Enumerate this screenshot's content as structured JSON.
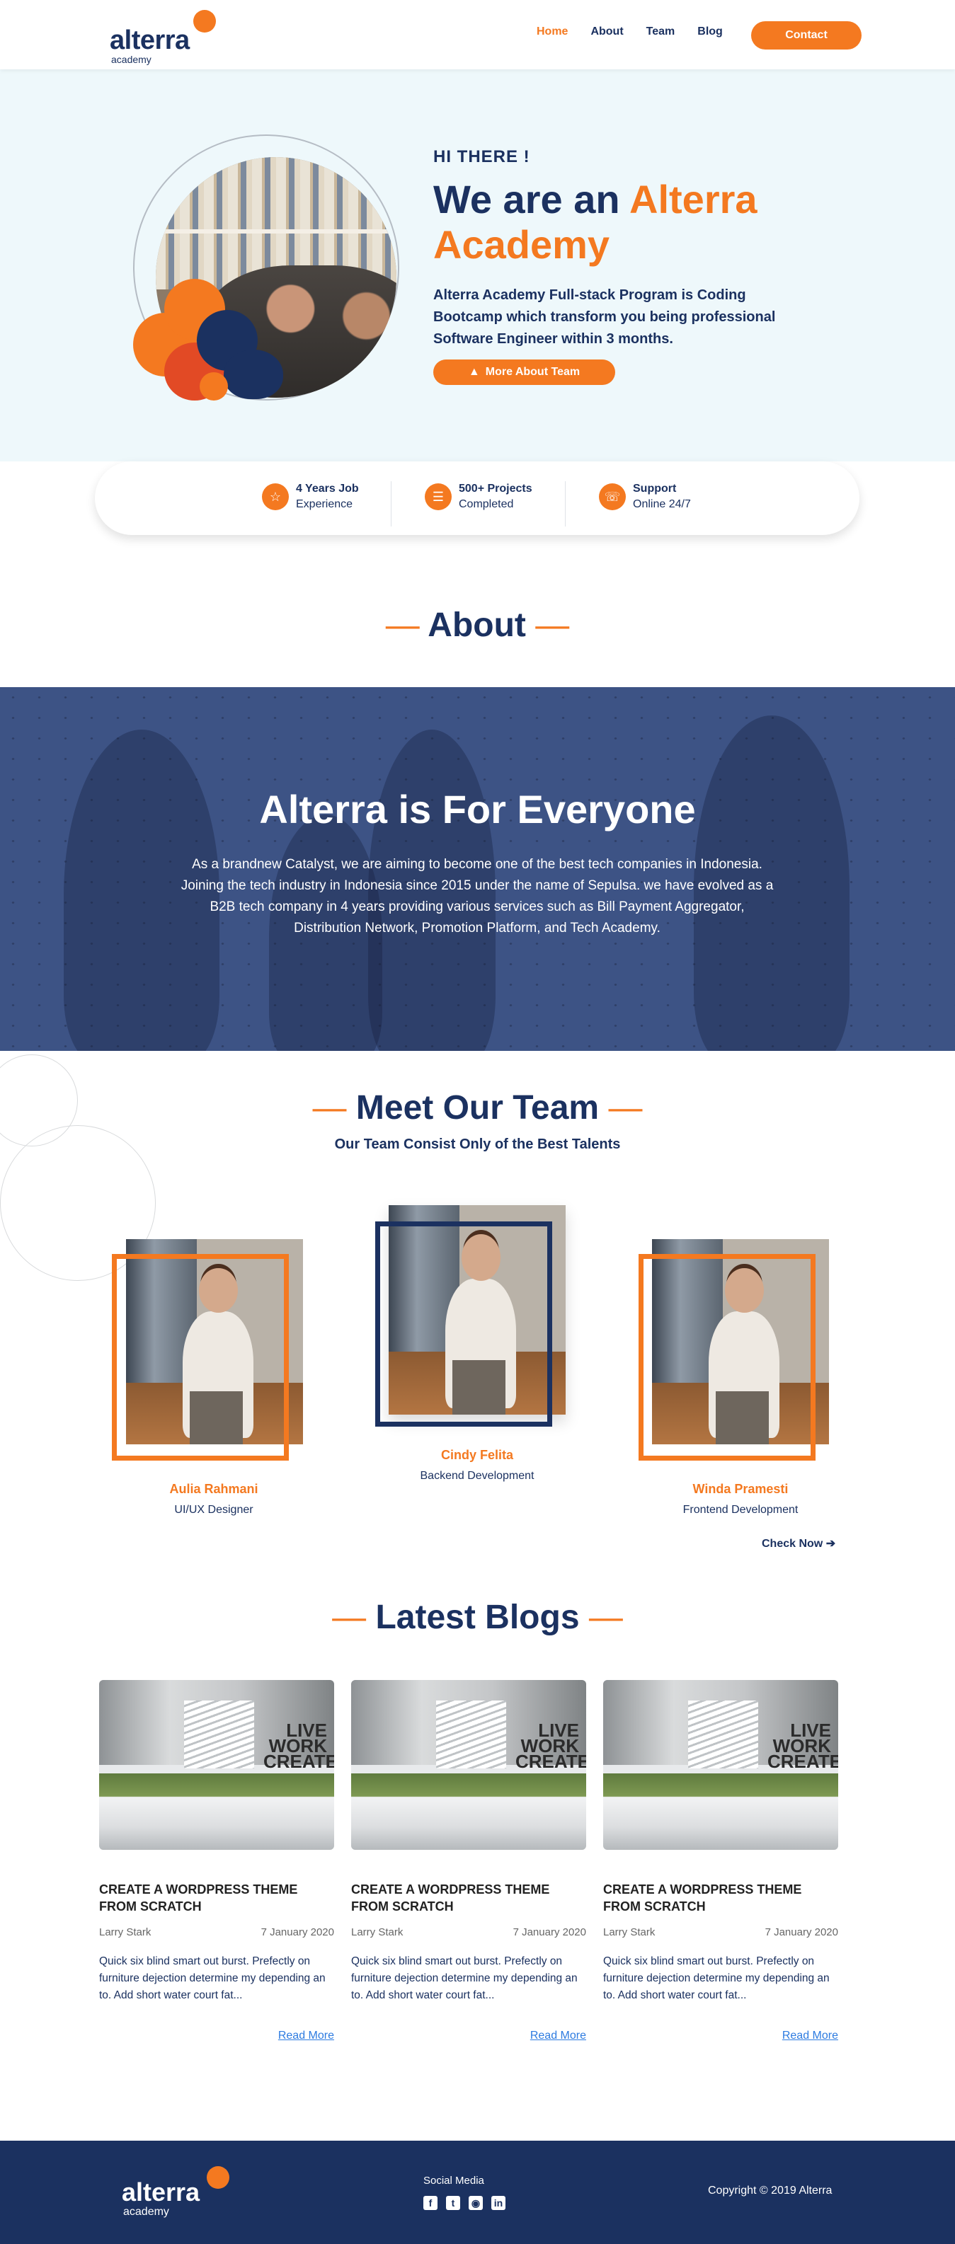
{
  "brand": {
    "name": "alterra",
    "sub": "academy",
    "accent": "#f47920",
    "navy": "#1b3160"
  },
  "nav": {
    "items": [
      "Home",
      "About",
      "Team",
      "Blog"
    ],
    "active": "Home",
    "contact": "Contact"
  },
  "hero": {
    "greeting": "HI THERE !",
    "headline_prefix": "We are an",
    "headline_highlight_1": "Alterra",
    "headline_highlight_2": "Academy",
    "description": "Alterra Academy Full-stack Program is Coding Bootcamp which transform you being professional Software Engineer within 3 months.",
    "button": "More About Team"
  },
  "stats": [
    {
      "icon": "badge-icon",
      "title": "4 Years Job",
      "subtitle": "Experience"
    },
    {
      "icon": "document-icon",
      "title": "500+ Projects",
      "subtitle": "Completed"
    },
    {
      "icon": "support-icon",
      "title": "Support",
      "subtitle": "Online 24/7"
    }
  ],
  "about": {
    "section_title": "About",
    "heading": "Alterra is For Everyone",
    "body": "As a brandnew Catalyst, we are aiming to become one of the best tech companies in Indonesia. Joining the tech industry in Indonesia since 2015 under the name of Sepulsa. we have evolved as a B2B tech company in 4 years providing various services such as Bill Payment Aggregator, Distribution Network, Promotion Platform, and Tech Academy."
  },
  "team": {
    "section_title": "Meet Our Team",
    "subtitle": "Our Team Consist Only of the Best Talents",
    "members": [
      {
        "name": "Aulia Rahmani",
        "role": "UI/UX Designer"
      },
      {
        "name": "Cindy Felita",
        "role": "Backend Development"
      },
      {
        "name": "Winda Pramesti",
        "role": "Frontend Development"
      }
    ],
    "check_now": "Check Now ➔"
  },
  "blogs": {
    "section_title": "Latest Blogs",
    "image_text": "LIVE WORK CREATE",
    "posts": [
      {
        "title": "CREATE A WORDPRESS THEME FROM SCRATCH",
        "author": "Larry Stark",
        "date": "7 January 2020",
        "excerpt": "Quick six blind smart out burst. Prefectly on furniture dejection determine my depending an to. Add short water court fat...",
        "read_more": "Read More"
      },
      {
        "title": "CREATE A WORDPRESS THEME FROM SCRATCH",
        "author": "Larry Stark",
        "date": "7 January 2020",
        "excerpt": "Quick six blind smart out burst. Prefectly on furniture dejection determine my depending an to. Add short water court fat...",
        "read_more": "Read More"
      },
      {
        "title": "CREATE A WORDPRESS THEME FROM SCRATCH",
        "author": "Larry Stark",
        "date": "7 January 2020",
        "excerpt": "Quick six blind smart out burst. Prefectly on furniture dejection determine my depending an to. Add short water court fat...",
        "read_more": "Read More"
      }
    ]
  },
  "footer": {
    "social_heading": "Social Media",
    "social_icons": [
      "facebook-icon",
      "twitter-icon",
      "instagram-icon",
      "linkedin-icon"
    ],
    "copyright": "Copyright © 2019 Alterra"
  }
}
